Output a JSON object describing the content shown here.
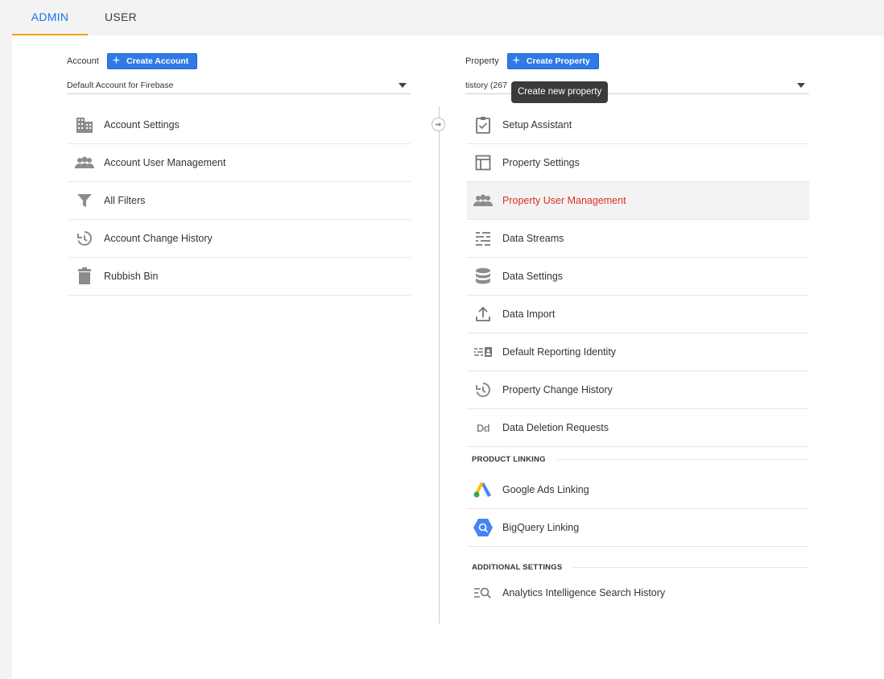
{
  "tabs": {
    "admin": "ADMIN",
    "user": "USER"
  },
  "account": {
    "label": "Account",
    "create_button": "Create Account",
    "selected": "Default Account for Firebase",
    "items": [
      {
        "label": "Account Settings",
        "icon": "building-icon"
      },
      {
        "label": "Account User Management",
        "icon": "people-icon"
      },
      {
        "label": "All Filters",
        "icon": "filter-icon"
      },
      {
        "label": "Account Change History",
        "icon": "history-icon"
      },
      {
        "label": "Rubbish Bin",
        "icon": "trash-icon"
      }
    ]
  },
  "property": {
    "label": "Property",
    "create_button": "Create Property",
    "selected": "tistory (267",
    "tooltip": "Create new property",
    "items": [
      {
        "label": "Setup Assistant",
        "icon": "checklist-icon"
      },
      {
        "label": "Property Settings",
        "icon": "layout-icon"
      },
      {
        "label": "Property User Management",
        "icon": "people-icon"
      },
      {
        "label": "Data Streams",
        "icon": "streams-icon"
      },
      {
        "label": "Data Settings",
        "icon": "database-icon"
      },
      {
        "label": "Data Import",
        "icon": "upload-icon"
      },
      {
        "label": "Default Reporting Identity",
        "icon": "identity-icon"
      },
      {
        "label": "Property Change History",
        "icon": "history-icon"
      },
      {
        "label": "Data Deletion Requests",
        "icon": "dd-icon"
      }
    ],
    "product_linking": {
      "title": "PRODUCT LINKING",
      "items": [
        {
          "label": "Google Ads Linking",
          "icon": "google-ads-icon"
        },
        {
          "label": "BigQuery Linking",
          "icon": "bigquery-icon"
        }
      ]
    },
    "additional_settings": {
      "title": "ADDITIONAL SETTINGS",
      "items": [
        {
          "label": "Analytics Intelligence Search History",
          "icon": "search-history-icon"
        }
      ]
    }
  },
  "colors": {
    "accent": "#1a73e8",
    "tab_underline": "#f4a11d",
    "active_item": "#d93025",
    "button": "#2f7ae5"
  }
}
